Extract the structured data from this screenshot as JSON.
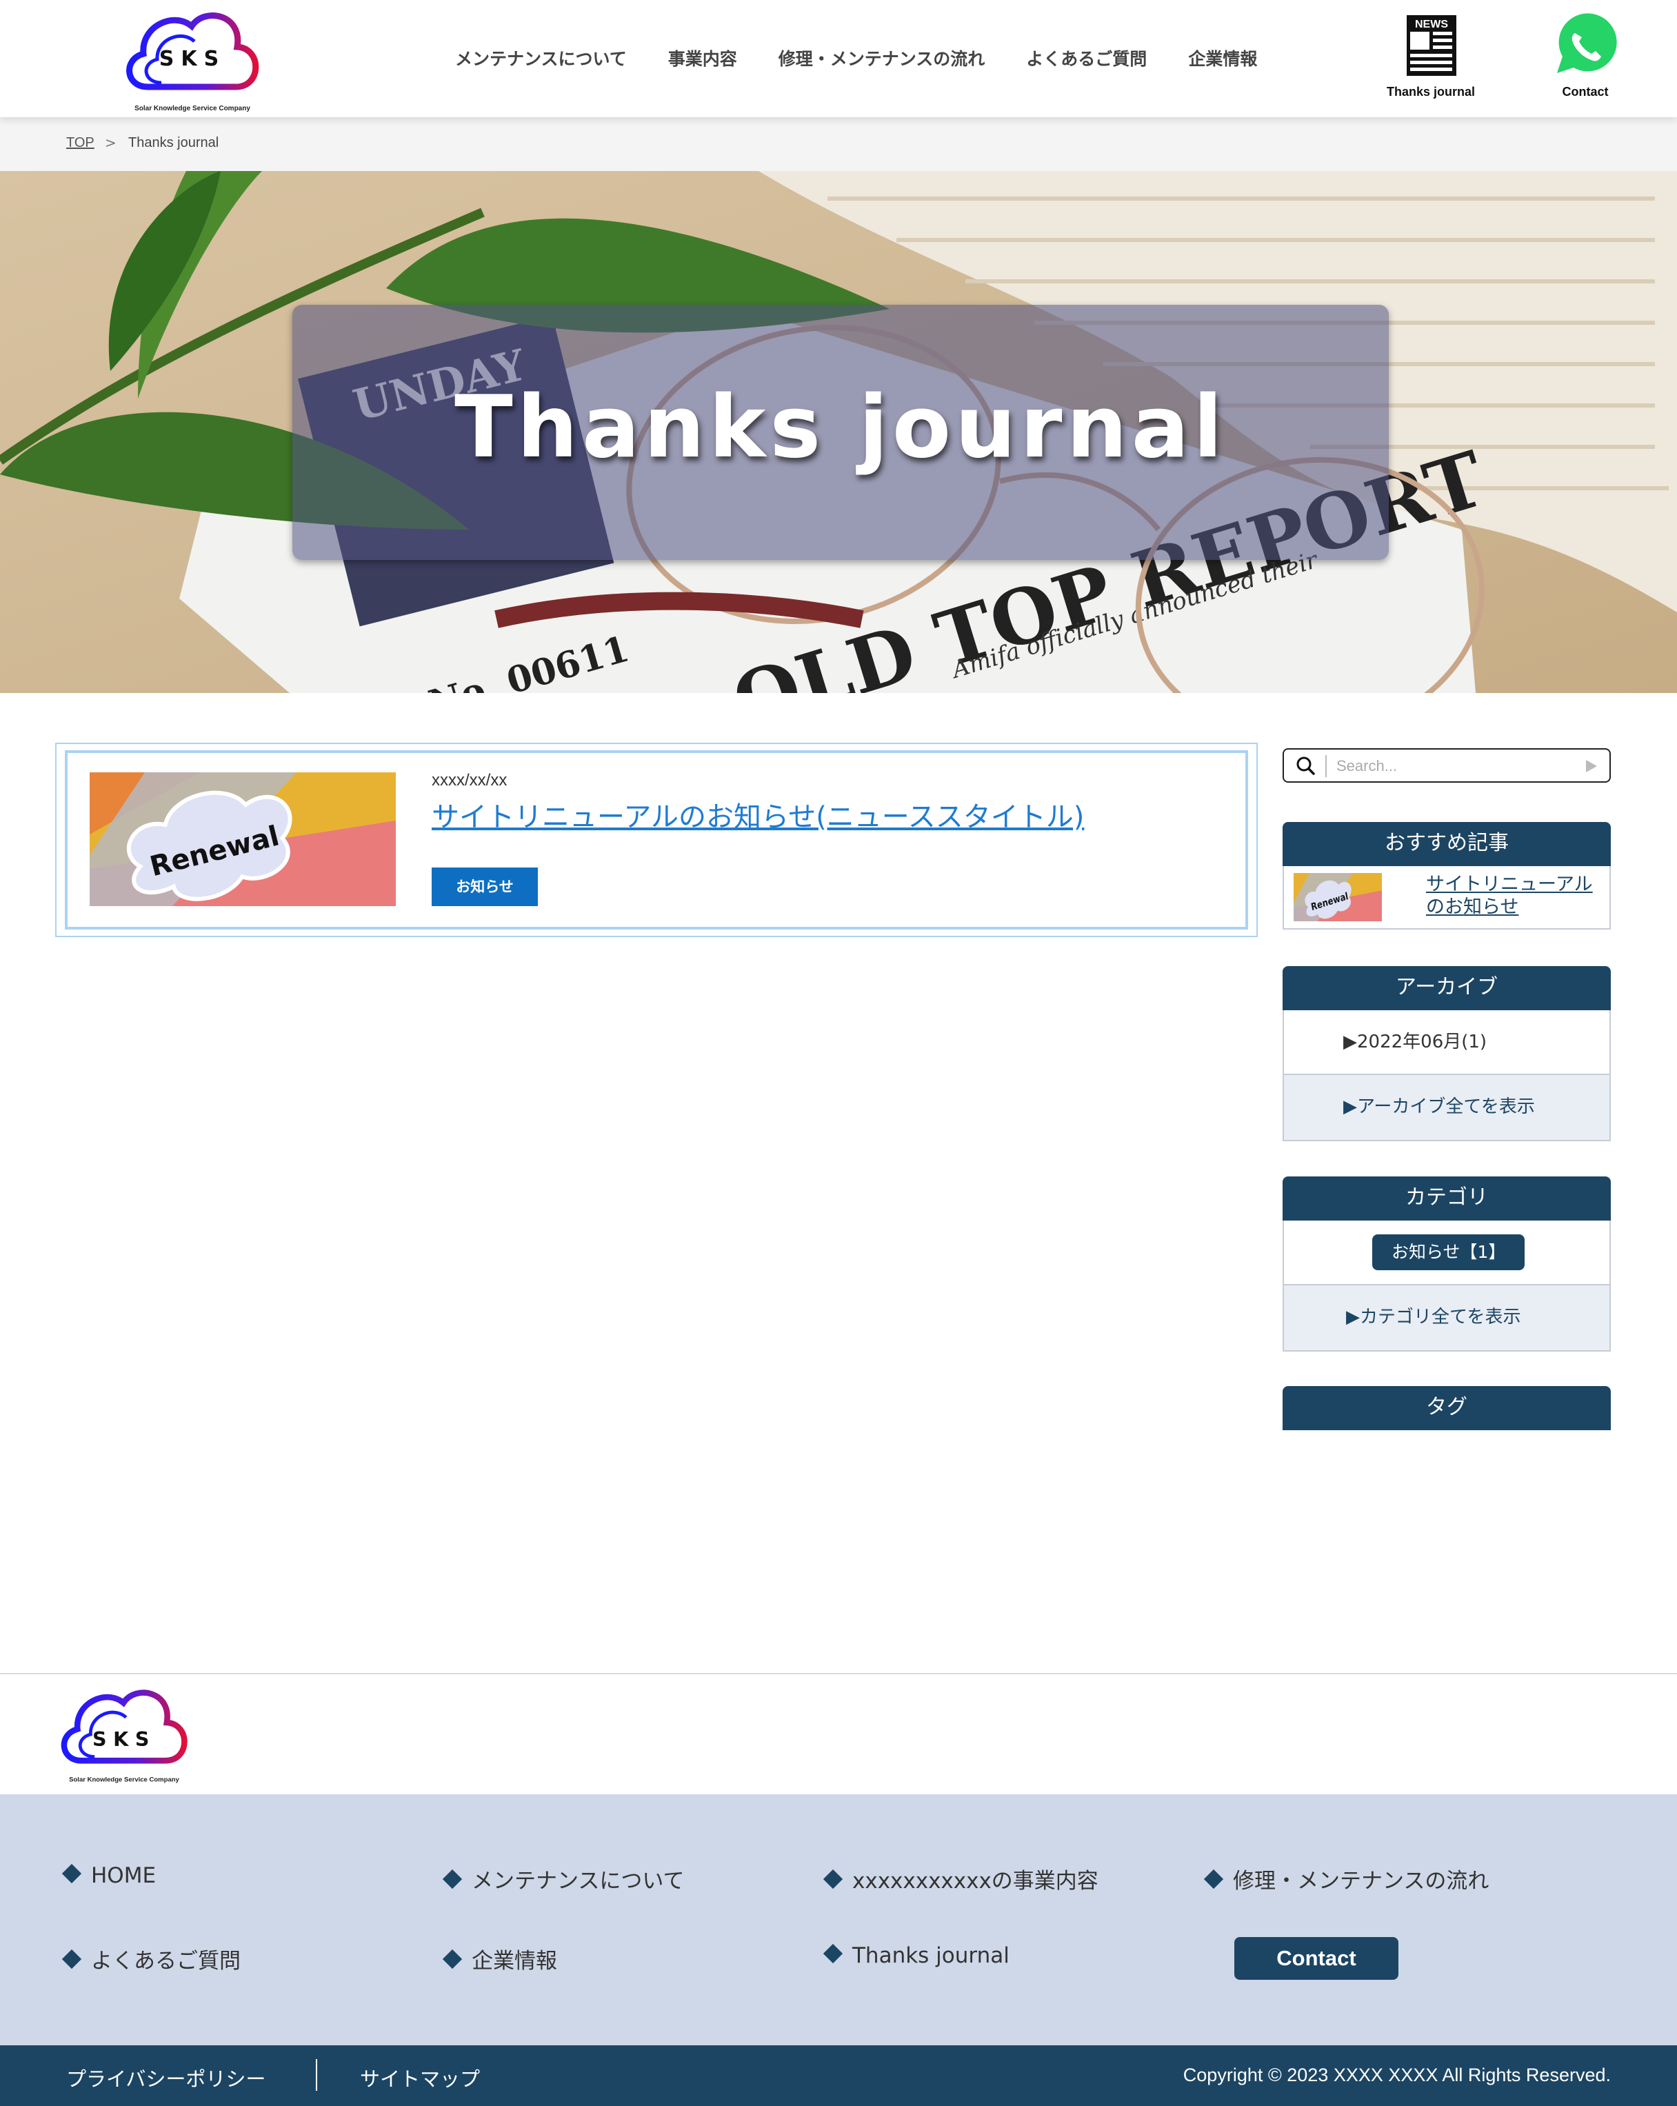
{
  "header": {
    "logo": {
      "letters": "SKS",
      "tagline": "Solar Knowledge Service Company"
    },
    "nav": [
      "メンテナンスについて",
      "事業内容",
      "修理・メンテナンスの流れ",
      "よくあるご質問",
      "企業情報"
    ],
    "news_badge": "NEWS",
    "journal_label": "Thanks journal",
    "contact_label": "Contact"
  },
  "breadcrumb": {
    "top": "TOP",
    "separator": ">",
    "current": "Thanks journal"
  },
  "hero": {
    "title": "Thanks journal"
  },
  "post": {
    "date": "xxxx/xx/xx",
    "title": "サイトリニューアルのお知らせ(ニューススタイトル)",
    "category": "お知らせ",
    "thumb_text": "Renewal"
  },
  "sidebar": {
    "search_placeholder": "Search...",
    "recommended": {
      "heading": "おすすめ記事",
      "item_line1": "サイトリニューアル",
      "item_line2": "のお知らせ",
      "thumb_text": "Renewal"
    },
    "archive": {
      "heading": "アーカイブ",
      "entry": "▶2022年06月(1)",
      "show_all": "▶アーカイブ全てを表示"
    },
    "category": {
      "heading": "カテゴリ",
      "pill": "お知らせ【1】",
      "show_all": "▶カテゴリ全てを表示"
    },
    "tags": {
      "heading": "タグ"
    }
  },
  "footer": {
    "logo": {
      "letters": "SKS",
      "tagline": "Solar Knowledge Service Company"
    },
    "links": [
      "HOME",
      "メンテナンスについて",
      "xxxxxxxxxxxの事業内容",
      "修理・メンテナンスの流れ",
      "よくあるご質問",
      "企業情報",
      "Thanks journal"
    ],
    "contact": "Contact",
    "privacy": "プライバシーポリシー",
    "sitemap": "サイトマップ",
    "copyright": "Copyright © 2023 XXXX XXXX All Rights Reserved."
  },
  "colors": {
    "navy": "#1c4563",
    "link_blue": "#1f7bd0",
    "category_blue": "#0e6fc2",
    "card_border": "#a9d4f2",
    "footer_bg": "#cfd8e8",
    "whatsapp_green": "#25d366"
  }
}
